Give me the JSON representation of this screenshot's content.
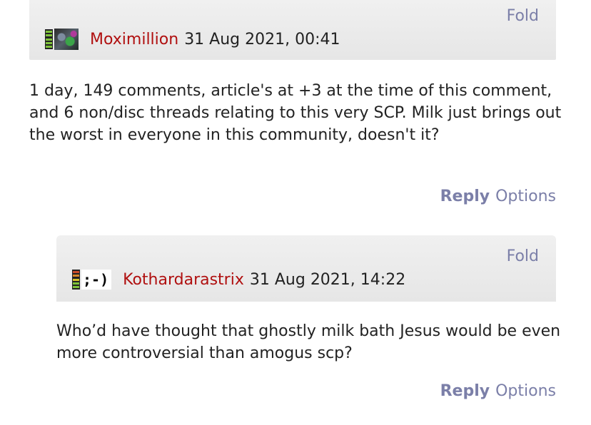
{
  "comments": [
    {
      "fold_label": "Fold",
      "author": "Moximillion",
      "timestamp": "31 Aug 2021, 00:41",
      "avatar": "image-avatar",
      "body": "1 day, 149 comments, article's at +3 at the time of this comment, and 6 non/disc threads relating to this very SCP. Milk just brings out the worst in everyone in this community, doesn't it?",
      "reply_label": "Reply",
      "options_label": "Options"
    },
    {
      "fold_label": "Fold",
      "author": "Kothardarastrix",
      "timestamp": "31 Aug 2021, 14:22",
      "avatar_text": ";-)",
      "body": "Who’d have thought that ghostly milk bath Jesus would be even more controversial than amogus scp?",
      "reply_label": "Reply",
      "options_label": "Options"
    }
  ],
  "colors": {
    "username": "#b01010",
    "link": "#7b7fa8",
    "header_bg": "#ececec"
  },
  "icons": [
    "karma-meter-icon",
    "user-avatar-icon"
  ]
}
